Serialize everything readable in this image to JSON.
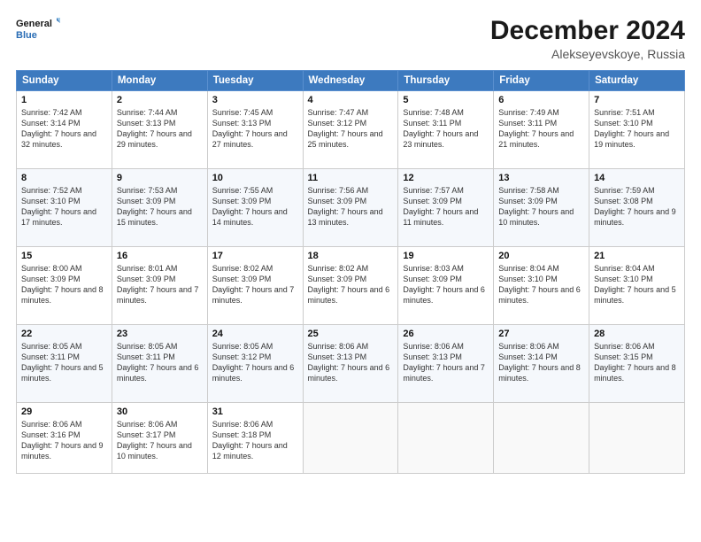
{
  "header": {
    "logo_line1": "General",
    "logo_line2": "Blue",
    "month": "December 2024",
    "location": "Alekseyevskoye, Russia"
  },
  "days_of_week": [
    "Sunday",
    "Monday",
    "Tuesday",
    "Wednesday",
    "Thursday",
    "Friday",
    "Saturday"
  ],
  "weeks": [
    [
      {
        "day": "1",
        "rise": "Sunrise: 7:42 AM",
        "set": "Sunset: 3:14 PM",
        "daylight": "Daylight: 7 hours and 32 minutes."
      },
      {
        "day": "2",
        "rise": "Sunrise: 7:44 AM",
        "set": "Sunset: 3:13 PM",
        "daylight": "Daylight: 7 hours and 29 minutes."
      },
      {
        "day": "3",
        "rise": "Sunrise: 7:45 AM",
        "set": "Sunset: 3:13 PM",
        "daylight": "Daylight: 7 hours and 27 minutes."
      },
      {
        "day": "4",
        "rise": "Sunrise: 7:47 AM",
        "set": "Sunset: 3:12 PM",
        "daylight": "Daylight: 7 hours and 25 minutes."
      },
      {
        "day": "5",
        "rise": "Sunrise: 7:48 AM",
        "set": "Sunset: 3:11 PM",
        "daylight": "Daylight: 7 hours and 23 minutes."
      },
      {
        "day": "6",
        "rise": "Sunrise: 7:49 AM",
        "set": "Sunset: 3:11 PM",
        "daylight": "Daylight: 7 hours and 21 minutes."
      },
      {
        "day": "7",
        "rise": "Sunrise: 7:51 AM",
        "set": "Sunset: 3:10 PM",
        "daylight": "Daylight: 7 hours and 19 minutes."
      }
    ],
    [
      {
        "day": "8",
        "rise": "Sunrise: 7:52 AM",
        "set": "Sunset: 3:10 PM",
        "daylight": "Daylight: 7 hours and 17 minutes."
      },
      {
        "day": "9",
        "rise": "Sunrise: 7:53 AM",
        "set": "Sunset: 3:09 PM",
        "daylight": "Daylight: 7 hours and 15 minutes."
      },
      {
        "day": "10",
        "rise": "Sunrise: 7:55 AM",
        "set": "Sunset: 3:09 PM",
        "daylight": "Daylight: 7 hours and 14 minutes."
      },
      {
        "day": "11",
        "rise": "Sunrise: 7:56 AM",
        "set": "Sunset: 3:09 PM",
        "daylight": "Daylight: 7 hours and 13 minutes."
      },
      {
        "day": "12",
        "rise": "Sunrise: 7:57 AM",
        "set": "Sunset: 3:09 PM",
        "daylight": "Daylight: 7 hours and 11 minutes."
      },
      {
        "day": "13",
        "rise": "Sunrise: 7:58 AM",
        "set": "Sunset: 3:09 PM",
        "daylight": "Daylight: 7 hours and 10 minutes."
      },
      {
        "day": "14",
        "rise": "Sunrise: 7:59 AM",
        "set": "Sunset: 3:08 PM",
        "daylight": "Daylight: 7 hours and 9 minutes."
      }
    ],
    [
      {
        "day": "15",
        "rise": "Sunrise: 8:00 AM",
        "set": "Sunset: 3:09 PM",
        "daylight": "Daylight: 7 hours and 8 minutes."
      },
      {
        "day": "16",
        "rise": "Sunrise: 8:01 AM",
        "set": "Sunset: 3:09 PM",
        "daylight": "Daylight: 7 hours and 7 minutes."
      },
      {
        "day": "17",
        "rise": "Sunrise: 8:02 AM",
        "set": "Sunset: 3:09 PM",
        "daylight": "Daylight: 7 hours and 7 minutes."
      },
      {
        "day": "18",
        "rise": "Sunrise: 8:02 AM",
        "set": "Sunset: 3:09 PM",
        "daylight": "Daylight: 7 hours and 6 minutes."
      },
      {
        "day": "19",
        "rise": "Sunrise: 8:03 AM",
        "set": "Sunset: 3:09 PM",
        "daylight": "Daylight: 7 hours and 6 minutes."
      },
      {
        "day": "20",
        "rise": "Sunrise: 8:04 AM",
        "set": "Sunset: 3:10 PM",
        "daylight": "Daylight: 7 hours and 6 minutes."
      },
      {
        "day": "21",
        "rise": "Sunrise: 8:04 AM",
        "set": "Sunset: 3:10 PM",
        "daylight": "Daylight: 7 hours and 5 minutes."
      }
    ],
    [
      {
        "day": "22",
        "rise": "Sunrise: 8:05 AM",
        "set": "Sunset: 3:11 PM",
        "daylight": "Daylight: 7 hours and 5 minutes."
      },
      {
        "day": "23",
        "rise": "Sunrise: 8:05 AM",
        "set": "Sunset: 3:11 PM",
        "daylight": "Daylight: 7 hours and 6 minutes."
      },
      {
        "day": "24",
        "rise": "Sunrise: 8:05 AM",
        "set": "Sunset: 3:12 PM",
        "daylight": "Daylight: 7 hours and 6 minutes."
      },
      {
        "day": "25",
        "rise": "Sunrise: 8:06 AM",
        "set": "Sunset: 3:13 PM",
        "daylight": "Daylight: 7 hours and 6 minutes."
      },
      {
        "day": "26",
        "rise": "Sunrise: 8:06 AM",
        "set": "Sunset: 3:13 PM",
        "daylight": "Daylight: 7 hours and 7 minutes."
      },
      {
        "day": "27",
        "rise": "Sunrise: 8:06 AM",
        "set": "Sunset: 3:14 PM",
        "daylight": "Daylight: 7 hours and 8 minutes."
      },
      {
        "day": "28",
        "rise": "Sunrise: 8:06 AM",
        "set": "Sunset: 3:15 PM",
        "daylight": "Daylight: 7 hours and 8 minutes."
      }
    ],
    [
      {
        "day": "29",
        "rise": "Sunrise: 8:06 AM",
        "set": "Sunset: 3:16 PM",
        "daylight": "Daylight: 7 hours and 9 minutes."
      },
      {
        "day": "30",
        "rise": "Sunrise: 8:06 AM",
        "set": "Sunset: 3:17 PM",
        "daylight": "Daylight: 7 hours and 10 minutes."
      },
      {
        "day": "31",
        "rise": "Sunrise: 8:06 AM",
        "set": "Sunset: 3:18 PM",
        "daylight": "Daylight: 7 hours and 12 minutes."
      },
      null,
      null,
      null,
      null
    ]
  ]
}
